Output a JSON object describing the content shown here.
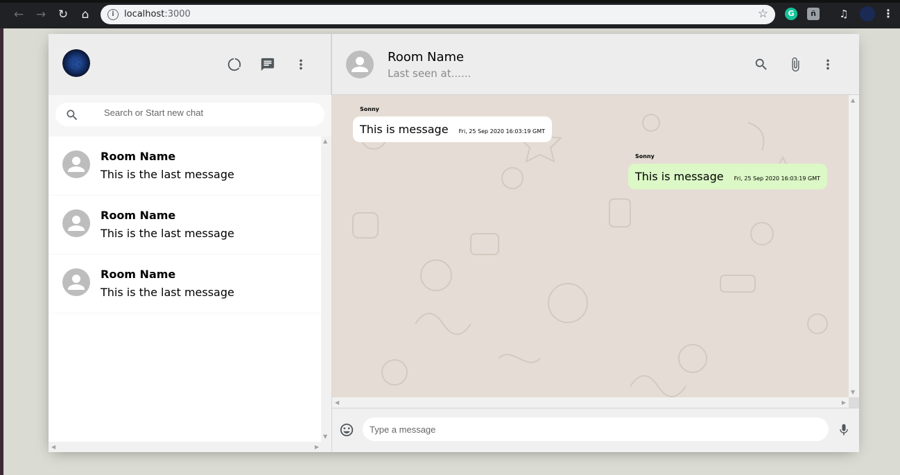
{
  "browser": {
    "url_host": "localhost",
    "url_port": ":3000",
    "info_glyph": "i"
  },
  "sidebar": {
    "search_placeholder": "Search or Start new chat",
    "chats": [
      {
        "name": "Room Name",
        "last_message": "This is the last message"
      },
      {
        "name": "Room Name",
        "last_message": "This is the last message"
      },
      {
        "name": "Room Name",
        "last_message": "This is the last message"
      }
    ]
  },
  "chat": {
    "room_name": "Room Name",
    "last_seen": "Last seen at......",
    "messages": [
      {
        "sender": "Sonny",
        "text": "This is message",
        "timestamp": "Fri, 25 Sep 2020 16:03:19 GMT",
        "direction": "received"
      },
      {
        "sender": "Sonny",
        "text": "This is message",
        "timestamp": "Fri, 25 Sep 2020 16:03:19 GMT",
        "direction": "sent"
      }
    ],
    "input_placeholder": "Type a message"
  },
  "colors": {
    "sent_bubble": "#dcf8c6",
    "received_bubble": "#ffffff",
    "chat_background": "#e5ddd5",
    "header_background": "#ededed"
  }
}
